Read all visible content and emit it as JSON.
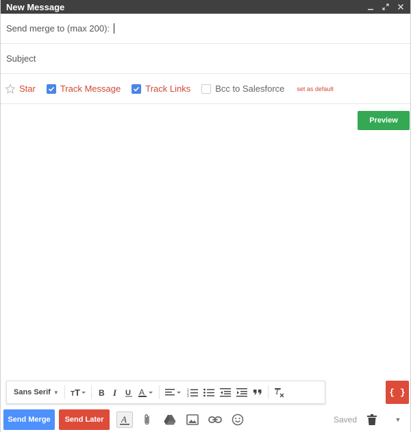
{
  "window": {
    "title": "New Message"
  },
  "fields": {
    "to_label": "Send merge to (max 200):",
    "subject_placeholder": "Subject"
  },
  "options": {
    "star_label": "Star",
    "track_message_label": "Track Message",
    "track_message_checked": true,
    "track_links_label": "Track Links",
    "track_links_checked": true,
    "bcc_label": "Bcc to Salesforce",
    "bcc_checked": false,
    "set_default_label": "set as default"
  },
  "preview": {
    "label": "Preview"
  },
  "formatting": {
    "font_label": "Sans Serif",
    "braces_label": "{ }"
  },
  "bottom": {
    "send_merge_label": "Send Merge",
    "send_later_label": "Send Later",
    "saved_label": "Saved"
  },
  "colors": {
    "titlebar": "#404040",
    "track_blue": "#4a86e8",
    "accent_red": "#dd4b39",
    "send_blue": "#4d90fe",
    "preview_green": "#34a853"
  },
  "icons": {
    "minimize": "minimize-icon",
    "expand": "expand-icon",
    "close": "close-icon",
    "star": "star-icon",
    "text_size": "text-size-icon",
    "bold": "bold-icon",
    "italic": "italic-icon",
    "underline": "underline-icon",
    "text_color": "text-color-icon",
    "align": "align-icon",
    "numbered_list": "numbered-list-icon",
    "bulleted_list": "bulleted-list-icon",
    "indent_less": "indent-less-icon",
    "indent_more": "indent-more-icon",
    "quote": "quote-icon",
    "clear_formatting": "clear-formatting-icon",
    "formatting_options": "formatting-options-icon",
    "attach": "paperclip-icon",
    "drive": "drive-icon",
    "photo": "photo-icon",
    "link": "link-icon",
    "emoji": "emoji-icon",
    "trash": "trash-icon",
    "more": "more-options-icon"
  }
}
